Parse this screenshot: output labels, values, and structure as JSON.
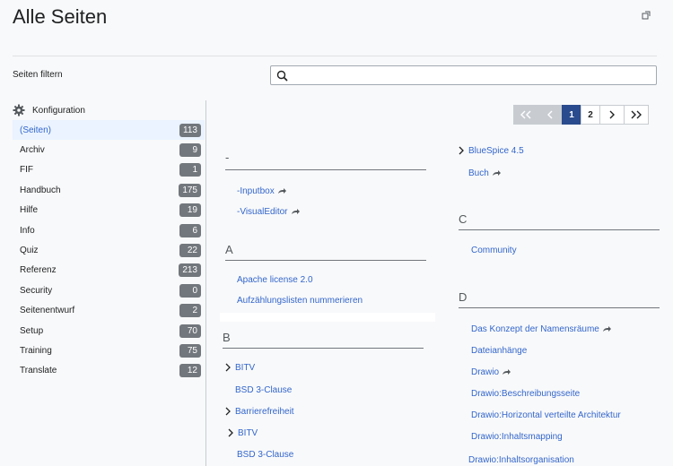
{
  "page": {
    "title": "Alle Seiten"
  },
  "filter": {
    "label": "Seiten filtern",
    "placeholder": "",
    "value": ""
  },
  "sidebar": {
    "config_label": "Konfiguration",
    "namespaces": [
      {
        "label": "(Seiten)",
        "count": "113",
        "active": true
      },
      {
        "label": "Archiv",
        "count": "9"
      },
      {
        "label": "FIF",
        "count": "1"
      },
      {
        "label": "Handbuch",
        "count": "175"
      },
      {
        "label": "Hilfe",
        "count": "19"
      },
      {
        "label": "Info",
        "count": "6"
      },
      {
        "label": "Quiz",
        "count": "22"
      },
      {
        "label": "Referenz",
        "count": "213"
      },
      {
        "label": "Security",
        "count": "0"
      },
      {
        "label": "Seitenentwurf",
        "count": "2"
      },
      {
        "label": "Setup",
        "count": "70"
      },
      {
        "label": "Training",
        "count": "75"
      },
      {
        "label": "Translate",
        "count": "12"
      }
    ]
  },
  "pager": {
    "page1": "1",
    "page2": "2"
  },
  "sections": {
    "dash": {
      "heading": "-",
      "items": [
        "-Inputbox",
        "-VisualEditor"
      ]
    },
    "a": {
      "heading": "A",
      "items": [
        "Apache license 2.0",
        "Aufzählungslisten nummerieren"
      ]
    },
    "b": {
      "heading": "B",
      "items": [
        "BITV",
        "BSD 3-Clause",
        "Barrierefreiheit",
        "BITV",
        "BSD 3-Clause"
      ]
    },
    "top_right": {
      "items": [
        "BlueSpice 4.5",
        "Buch"
      ]
    },
    "c": {
      "heading": "C",
      "items": [
        "Community"
      ]
    },
    "d": {
      "heading": "D",
      "items": [
        "Das Konzept der Namensräume",
        "Dateianhänge",
        "Drawio",
        "Drawio:Beschreibungsseite",
        "Drawio:Horizontal verteilte Architektur",
        "Drawio:Inhaltsmapping",
        "Drawio:Inhaltsorganisation"
      ]
    }
  },
  "colors": {
    "link": "#3366cc",
    "active_page": "#2a4b8d",
    "badge": "#72777d"
  }
}
